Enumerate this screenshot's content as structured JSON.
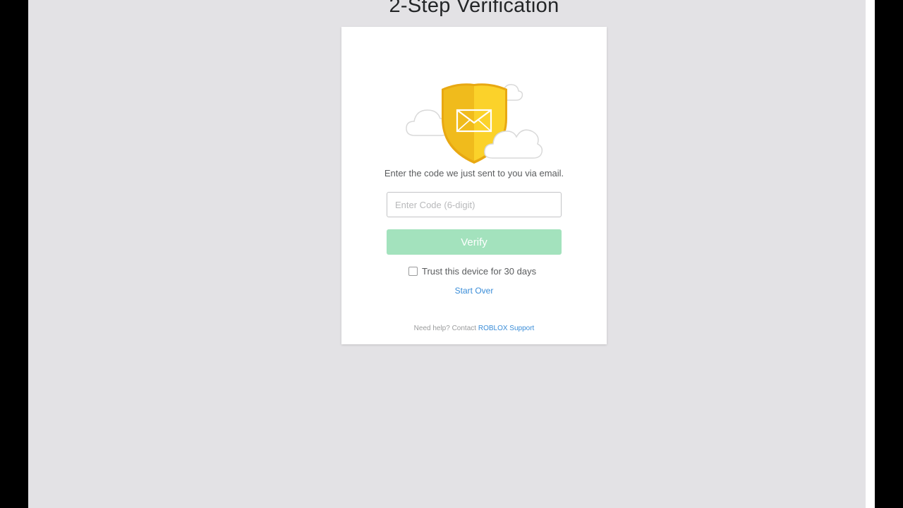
{
  "page": {
    "title": "2-Step Verification"
  },
  "card": {
    "instruction": "Enter the code we just sent to you via email.",
    "code_input": {
      "value": "",
      "placeholder": "Enter Code (6-digit)"
    },
    "verify_label": "Verify",
    "trust_device": {
      "label": "Trust this device for 30 days",
      "checked": false
    },
    "start_over_label": "Start Over",
    "help": {
      "prefix": "Need help? Contact",
      "link_label": "ROBLOX Support"
    }
  },
  "icons": {
    "illustration": "shield-envelope-icon",
    "cloud_left": "cloud-icon",
    "cloud_right": "cloud-icon"
  },
  "colors": {
    "background": "#e3e2e5",
    "card": "#ffffff",
    "verify_button_disabled": "#a3e2bd",
    "link": "#3a8dd8",
    "shield_gold": "#f5c518"
  }
}
